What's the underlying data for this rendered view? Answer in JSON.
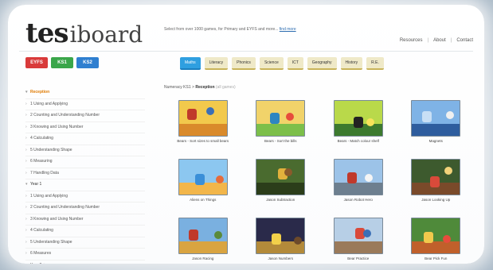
{
  "logo": {
    "tes": "tes",
    "iboard": "iboard"
  },
  "tagline": {
    "text": "Select from over 1000 games, for Primary and EYFS and more...",
    "link": "find more"
  },
  "top_links": {
    "resources": "Resources",
    "about": "About",
    "contact": "Contact",
    "sep": "|"
  },
  "stages": [
    {
      "label": "EYFS",
      "color": "#d93a3a"
    },
    {
      "label": "KS1",
      "color": "#3aa64a"
    },
    {
      "label": "KS2",
      "color": "#2f7fd0"
    }
  ],
  "subjects": [
    {
      "label": "Maths",
      "active": true
    },
    {
      "label": "Literacy"
    },
    {
      "label": "Phonics"
    },
    {
      "label": "Science"
    },
    {
      "label": "ICT"
    },
    {
      "label": "Geography"
    },
    {
      "label": "History"
    },
    {
      "label": "R.E."
    }
  ],
  "sidebar": [
    {
      "label": "Reception",
      "group": true,
      "active": true
    },
    {
      "label": "1 Using and Applying"
    },
    {
      "label": "2 Counting and Understanding Number"
    },
    {
      "label": "3 Knowing and Using Number"
    },
    {
      "label": "4 Calculating"
    },
    {
      "label": "5 Understanding Shape"
    },
    {
      "label": "6 Measuring"
    },
    {
      "label": "7 Handling Data"
    },
    {
      "label": "Year 1",
      "group": true
    },
    {
      "label": "1 Using and Applying"
    },
    {
      "label": "2 Counting and Understanding Number"
    },
    {
      "label": "3 Knowing and Using Number"
    },
    {
      "label": "4 Calculating"
    },
    {
      "label": "5 Understanding Shape"
    },
    {
      "label": "6 Measures"
    },
    {
      "label": "Year 2 +"
    }
  ],
  "breadcrumb": {
    "root": "Numeracy KS1",
    "sep": ">",
    "current": "Reception",
    "suffix": "(all games)"
  },
  "games": [
    {
      "label": "Bears - Sort sizes to small bears",
      "bg": "#f2c94c",
      "ground": "#d98a2b",
      "a": "#c0392b",
      "b": "#3b6fb6"
    },
    {
      "label": "Bears - Sort the bills",
      "bg": "#f1d36a",
      "ground": "#7cbf4a",
      "a": "#2e86c1",
      "b": "#e74c3c"
    },
    {
      "label": "Bears - Match colour shelf",
      "bg": "#b9d94a",
      "ground": "#3c7a2e",
      "a": "#222222",
      "b": "#f7e35a"
    },
    {
      "label": "Magnets",
      "bg": "#7fb3e6",
      "ground": "#2e5d9e",
      "a": "#c8dff5",
      "b": "#f0f0f0"
    },
    {
      "label": "Aliens on Things",
      "bg": "#8cc7f0",
      "ground": "#f2b64a",
      "a": "#3a8fd8",
      "b": "#e66b3a"
    },
    {
      "label": "Jason Subtraction",
      "bg": "#4a6b2f",
      "ground": "#2b3d1a",
      "a": "#e2b13c",
      "b": "#8b5a2b"
    },
    {
      "label": "Jason Robot Hero",
      "bg": "#9cc3e8",
      "ground": "#6d7f8f",
      "a": "#c0392b",
      "b": "#f5f5f5"
    },
    {
      "label": "Jason Looking Up",
      "bg": "#3d5a2e",
      "ground": "#7a4a2a",
      "a": "#d94a3a",
      "b": "#f2d27a"
    },
    {
      "label": "Jason Racing",
      "bg": "#7ab0e0",
      "ground": "#d9a441",
      "a": "#c0392b",
      "b": "#5a8a3a"
    },
    {
      "label": "Jason Numbers",
      "bg": "#2a2a4a",
      "ground": "#b38a3a",
      "a": "#f2d04a",
      "b": "#6d4a2a"
    },
    {
      "label": "Bear Practice",
      "bg": "#b7cfe6",
      "ground": "#9a7a5a",
      "a": "#d94a3a",
      "b": "#3b6fb6"
    },
    {
      "label": "Bear Pick Fun",
      "bg": "#4f8a3a",
      "ground": "#c0602b",
      "a": "#f2c94c",
      "b": "#e74c3c"
    }
  ]
}
